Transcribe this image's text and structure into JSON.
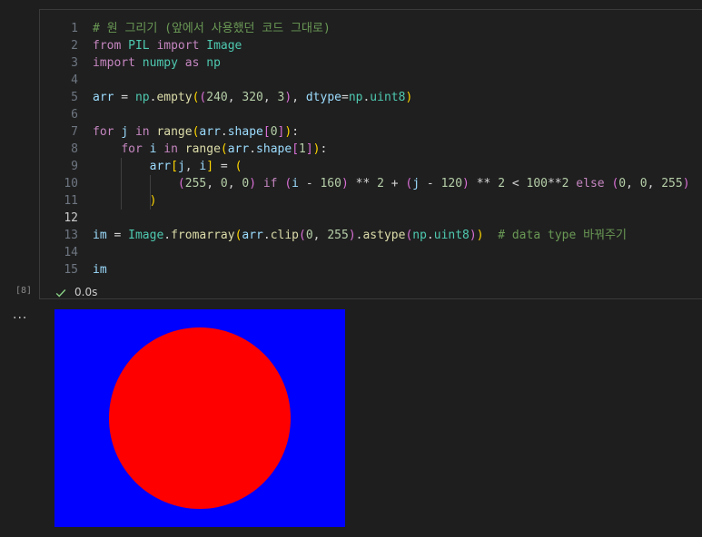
{
  "cell": {
    "execution_count": "[8]",
    "status_time": "0.0s",
    "status_icon": "check-icon",
    "active_line": 12,
    "lines": [
      {
        "n": "1",
        "tokens": [
          [
            "com",
            "# 원 그리기 (앞에서 사용했던 코드 그대로)"
          ]
        ]
      },
      {
        "n": "2",
        "tokens": [
          [
            "kw",
            "from"
          ],
          [
            "op",
            " "
          ],
          [
            "cls",
            "PIL"
          ],
          [
            "op",
            " "
          ],
          [
            "kw",
            "import"
          ],
          [
            "op",
            " "
          ],
          [
            "cls",
            "Image"
          ]
        ]
      },
      {
        "n": "3",
        "tokens": [
          [
            "kw",
            "import"
          ],
          [
            "op",
            " "
          ],
          [
            "cls",
            "numpy"
          ],
          [
            "op",
            " "
          ],
          [
            "kw",
            "as"
          ],
          [
            "op",
            " "
          ],
          [
            "cls",
            "np"
          ]
        ]
      },
      {
        "n": "4",
        "tokens": []
      },
      {
        "n": "5",
        "tokens": [
          [
            "var",
            "arr"
          ],
          [
            "op",
            " = "
          ],
          [
            "cls",
            "np"
          ],
          [
            "op",
            "."
          ],
          [
            "fn",
            "empty"
          ],
          [
            "p1",
            "("
          ],
          [
            "p2",
            "("
          ],
          [
            "num",
            "240"
          ],
          [
            "op",
            ", "
          ],
          [
            "num",
            "320"
          ],
          [
            "op",
            ", "
          ],
          [
            "num",
            "3"
          ],
          [
            "p2",
            ")"
          ],
          [
            "op",
            ", "
          ],
          [
            "var",
            "dtype"
          ],
          [
            "op",
            "="
          ],
          [
            "cls",
            "np"
          ],
          [
            "op",
            "."
          ],
          [
            "cls",
            "uint8"
          ],
          [
            "p1",
            ")"
          ]
        ]
      },
      {
        "n": "6",
        "tokens": []
      },
      {
        "n": "7",
        "tokens": [
          [
            "kw",
            "for"
          ],
          [
            "op",
            " "
          ],
          [
            "var",
            "j"
          ],
          [
            "op",
            " "
          ],
          [
            "kw",
            "in"
          ],
          [
            "op",
            " "
          ],
          [
            "fn",
            "range"
          ],
          [
            "p1",
            "("
          ],
          [
            "var",
            "arr"
          ],
          [
            "op",
            "."
          ],
          [
            "var",
            "shape"
          ],
          [
            "p2",
            "["
          ],
          [
            "num",
            "0"
          ],
          [
            "p2",
            "]"
          ],
          [
            "p1",
            ")"
          ],
          [
            "op",
            ":"
          ]
        ]
      },
      {
        "n": "8",
        "tokens": [
          [
            "op",
            "    "
          ],
          [
            "kw",
            "for"
          ],
          [
            "op",
            " "
          ],
          [
            "var",
            "i"
          ],
          [
            "op",
            " "
          ],
          [
            "kw",
            "in"
          ],
          [
            "op",
            " "
          ],
          [
            "fn",
            "range"
          ],
          [
            "p1",
            "("
          ],
          [
            "var",
            "arr"
          ],
          [
            "op",
            "."
          ],
          [
            "var",
            "shape"
          ],
          [
            "p2",
            "["
          ],
          [
            "num",
            "1"
          ],
          [
            "p2",
            "]"
          ],
          [
            "p1",
            ")"
          ],
          [
            "op",
            ":"
          ]
        ]
      },
      {
        "n": "9",
        "tokens": [
          [
            "op",
            "        "
          ],
          [
            "var",
            "arr"
          ],
          [
            "p1",
            "["
          ],
          [
            "var",
            "j"
          ],
          [
            "op",
            ", "
          ],
          [
            "var",
            "i"
          ],
          [
            "p1",
            "]"
          ],
          [
            "op",
            " = "
          ],
          [
            "p1",
            "("
          ]
        ]
      },
      {
        "n": "10",
        "tokens": [
          [
            "op",
            "            "
          ],
          [
            "p2",
            "("
          ],
          [
            "num",
            "255"
          ],
          [
            "op",
            ", "
          ],
          [
            "num",
            "0"
          ],
          [
            "op",
            ", "
          ],
          [
            "num",
            "0"
          ],
          [
            "p2",
            ")"
          ],
          [
            "op",
            " "
          ],
          [
            "kw",
            "if"
          ],
          [
            "op",
            " "
          ],
          [
            "p2",
            "("
          ],
          [
            "var",
            "i"
          ],
          [
            "op",
            " - "
          ],
          [
            "num",
            "160"
          ],
          [
            "p2",
            ")"
          ],
          [
            "op",
            " ** "
          ],
          [
            "num",
            "2"
          ],
          [
            "op",
            " + "
          ],
          [
            "p2",
            "("
          ],
          [
            "var",
            "j"
          ],
          [
            "op",
            " - "
          ],
          [
            "num",
            "120"
          ],
          [
            "p2",
            ")"
          ],
          [
            "op",
            " ** "
          ],
          [
            "num",
            "2"
          ],
          [
            "op",
            " < "
          ],
          [
            "num",
            "100"
          ],
          [
            "op",
            "**"
          ],
          [
            "num",
            "2"
          ],
          [
            "op",
            " "
          ],
          [
            "kw",
            "else"
          ],
          [
            "op",
            " "
          ],
          [
            "p2",
            "("
          ],
          [
            "num",
            "0"
          ],
          [
            "op",
            ", "
          ],
          [
            "num",
            "0"
          ],
          [
            "op",
            ", "
          ],
          [
            "num",
            "255"
          ],
          [
            "p2",
            ")"
          ]
        ]
      },
      {
        "n": "11",
        "tokens": [
          [
            "op",
            "        "
          ],
          [
            "p1",
            ")"
          ]
        ]
      },
      {
        "n": "12",
        "tokens": []
      },
      {
        "n": "13",
        "tokens": [
          [
            "var",
            "im"
          ],
          [
            "op",
            " = "
          ],
          [
            "cls",
            "Image"
          ],
          [
            "op",
            "."
          ],
          [
            "fn",
            "fromarray"
          ],
          [
            "p1",
            "("
          ],
          [
            "var",
            "arr"
          ],
          [
            "op",
            "."
          ],
          [
            "fn",
            "clip"
          ],
          [
            "p2",
            "("
          ],
          [
            "num",
            "0"
          ],
          [
            "op",
            ", "
          ],
          [
            "num",
            "255"
          ],
          [
            "p2",
            ")"
          ],
          [
            "op",
            "."
          ],
          [
            "fn",
            "astype"
          ],
          [
            "p2",
            "("
          ],
          [
            "cls",
            "np"
          ],
          [
            "op",
            "."
          ],
          [
            "cls",
            "uint8"
          ],
          [
            "p2",
            ")"
          ],
          [
            "p1",
            ")"
          ],
          [
            "op",
            "  "
          ],
          [
            "com",
            "# data type 바꿔주기"
          ]
        ]
      },
      {
        "n": "14",
        "tokens": []
      },
      {
        "n": "15",
        "tokens": [
          [
            "var",
            "im"
          ]
        ]
      }
    ]
  },
  "output": {
    "more_label": "...",
    "image": {
      "background_color": "#0000ff",
      "circle_color": "#ff0000"
    }
  },
  "colors": {
    "kw": "#c586c0",
    "fn": "#dcdcaa",
    "var": "#9cdcfe",
    "num": "#b5cea8",
    "cls": "#4ec9b0",
    "com": "#6a9955",
    "check": "#89d185"
  }
}
